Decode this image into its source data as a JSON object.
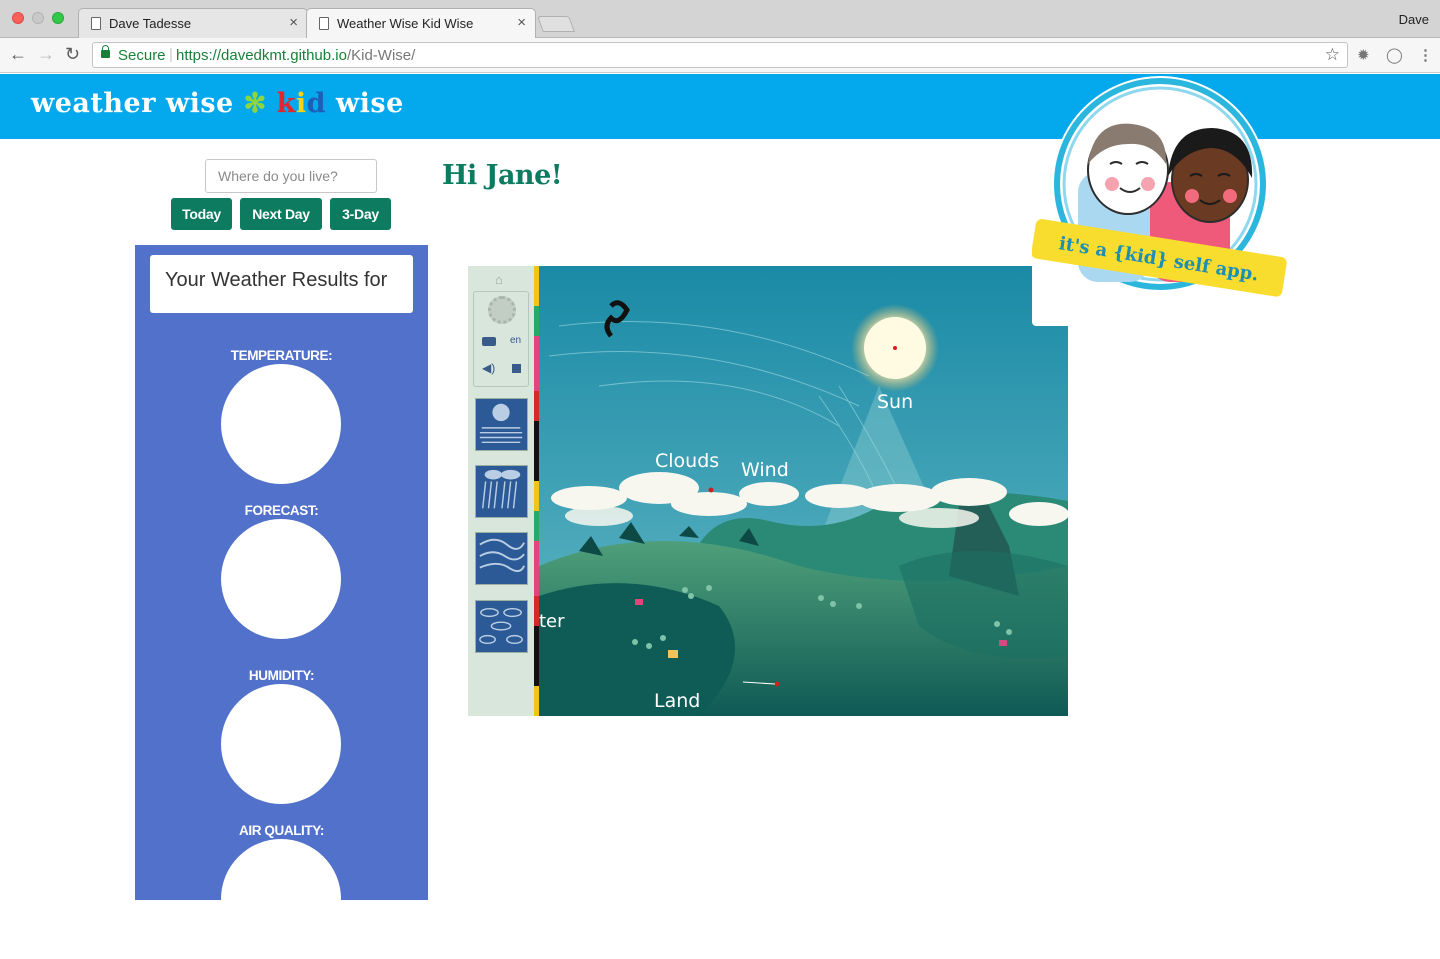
{
  "browser": {
    "tabs": [
      {
        "title": "Dave Tadesse",
        "active": false
      },
      {
        "title": "Weather Wise Kid Wise",
        "active": true
      }
    ],
    "profile_name": "Dave",
    "address": {
      "secure_label": "Secure",
      "url_host": "https://davedkmt.github.io",
      "url_path": "/Kid-Wise/"
    }
  },
  "header": {
    "logo_part1": "weather wise",
    "logo_spark": "✻",
    "logo_k": "k",
    "logo_i": "i",
    "logo_d": "d",
    "logo_part2": "wise",
    "brand_color": "#04a8ed"
  },
  "search": {
    "placeholder": "Where do you live?",
    "value": ""
  },
  "forecast_buttons": {
    "today": "Today",
    "next_day": "Next Day",
    "three_day": "3-Day",
    "color": "#0c7b60"
  },
  "results": {
    "title": "Your Weather Results for",
    "panel_color": "#5171cb",
    "metrics": [
      {
        "label": "TEMPERATURE:"
      },
      {
        "label": "FORECAST:"
      },
      {
        "label": "HUMIDITY:"
      },
      {
        "label": "AIR QUALITY:"
      }
    ]
  },
  "greeting": "Hi Jane!",
  "illustration": {
    "sidebar": {
      "lang": "en"
    },
    "labels": {
      "sun": "Sun",
      "clouds": "Clouds",
      "wind": "Wind",
      "water": "ter",
      "land": "Land"
    }
  },
  "badge": {
    "text": "it's a {kid} self app."
  }
}
